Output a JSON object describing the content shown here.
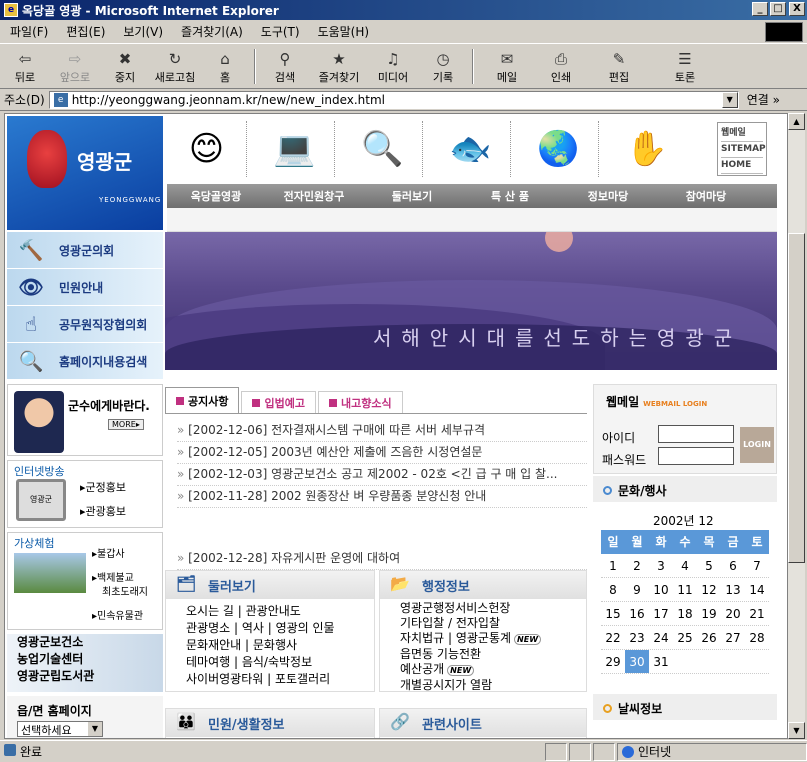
{
  "window": {
    "title": "옥당골 영광 - Microsoft Internet Explorer",
    "min": "_",
    "max": "□",
    "close": "X"
  },
  "menu": [
    "파일(F)",
    "편집(E)",
    "보기(V)",
    "즐겨찾기(A)",
    "도구(T)",
    "도움말(H)"
  ],
  "toolbar": [
    {
      "label": "뒤로",
      "icon": "⇦",
      "name": "back"
    },
    {
      "label": "앞으로",
      "icon": "⇨",
      "name": "forward",
      "disabled": true
    },
    {
      "label": "중지",
      "icon": "✖",
      "name": "stop"
    },
    {
      "label": "새로고침",
      "icon": "↻",
      "name": "refresh"
    },
    {
      "label": "홈",
      "icon": "⌂",
      "name": "home"
    },
    {
      "label": "검색",
      "icon": "⚲",
      "name": "search"
    },
    {
      "label": "즐겨찾기",
      "icon": "★",
      "name": "favorites"
    },
    {
      "label": "미디어",
      "icon": "♫",
      "name": "media"
    },
    {
      "label": "기록",
      "icon": "◷",
      "name": "history"
    },
    {
      "label": "메일",
      "icon": "✉",
      "name": "mail"
    },
    {
      "label": "인쇄",
      "icon": "⎙",
      "name": "print"
    },
    {
      "label": "편집",
      "icon": "✎",
      "name": "edit"
    },
    {
      "label": "토론",
      "icon": "☰",
      "name": "discuss"
    }
  ],
  "address": {
    "label": "주소(D)",
    "url": "http://yeonggwang.jeonnam.kr/new/new_index.html",
    "go": "연결 »"
  },
  "site": {
    "logo_title": "영광군",
    "logo_sub": "YEONGGWANG",
    "toplinks": [
      "웹메일",
      "SITEMAP",
      "HOME"
    ],
    "gnb": [
      "옥당골영광",
      "전자민원창구",
      "둘러보기",
      "특 산 품",
      "정보마당",
      "참여마당"
    ],
    "leftnav": [
      {
        "label": "영광군의회",
        "icon": "🔨"
      },
      {
        "label": "민원안내",
        "icon": "👁"
      },
      {
        "label": "공무원직장협의회",
        "icon": "☝"
      },
      {
        "label": "홈페이지내용검색",
        "icon": "🔍"
      }
    ],
    "slogan": "서해안시대를선도하는영광군",
    "chief": {
      "text": "군수에게바란다.",
      "more": "MORE▸"
    },
    "broadcast": {
      "title": "인터넷방송",
      "items": [
        "군정홍보",
        "관광홍보"
      ],
      "tv_label": "영광군"
    },
    "experience": {
      "title": "가상체험",
      "items": [
        "불갑사",
        "백제불교",
        "최초도래지",
        "민속유물관"
      ]
    },
    "links": [
      "영광군보건소",
      "농업기술센터",
      "영광군립도서관"
    ],
    "region": {
      "title": "읍/면 홈페이지",
      "select": "선택하세요"
    },
    "tabs": [
      "공지사항",
      "입법예고",
      "내고향소식"
    ],
    "news": [
      "[2002-12-06] 전자결재시스템 구매에 따른 서버 세부규격",
      "[2002-12-05] 2003년 예산안 제출에 즈음한 시정연설문",
      "[2002-12-03] 영광군보건소 공고 제2002 - 02호 <긴 급 구 매 입 찰...",
      "[2002-11-28] 2002 원종장산 벼 우량품종 분양신청 안내"
    ],
    "news_free": "[2002-12-28] 자유게시판 운영에 대하여",
    "box_tour": {
      "title": "둘러보기",
      "lines": [
        "오시는 길 | 관광안내도",
        "관광명소 | 역사 | 영광의 인물",
        "문화재안내 | 문화행사",
        "테마여행 | 음식/숙박정보",
        "사이버영광타워 | 포토갤러리"
      ]
    },
    "box_admin": {
      "title": "행정정보",
      "lines": [
        "영광군행정서비스헌장",
        "기타입찰 / 전자입찰",
        "자치법규 | 영광군통계",
        "읍면동 기능전환",
        "예산공개",
        "개별공시지가 열람"
      ],
      "new_label": "NEW"
    },
    "box_civil": {
      "title": "민원/생활정보"
    },
    "box_sites": {
      "title": "관련사이트"
    },
    "webmail": {
      "title": "웹메일",
      "sub": "WEBMAIL LOGIN",
      "id_label": "아이디",
      "pw_label": "패스워드",
      "login": "LOGIN"
    },
    "culture": "문화/행사",
    "calendar": {
      "ym": "2002년 12월",
      "days": [
        "일",
        "월",
        "화",
        "수",
        "목",
        "금",
        "토"
      ],
      "weeks": [
        [
          "1",
          "2",
          "3",
          "4",
          "5",
          "6",
          "7"
        ],
        [
          "8",
          "9",
          "10",
          "11",
          "12",
          "13",
          "14"
        ],
        [
          "15",
          "16",
          "17",
          "18",
          "19",
          "20",
          "21"
        ],
        [
          "22",
          "23",
          "24",
          "25",
          "26",
          "27",
          "28"
        ],
        [
          "29",
          "30",
          "31",
          "",
          "",
          "",
          ""
        ]
      ],
      "today": "30"
    },
    "weather": "날씨정보"
  },
  "status": {
    "text": "완료",
    "zone": "인터넷"
  }
}
